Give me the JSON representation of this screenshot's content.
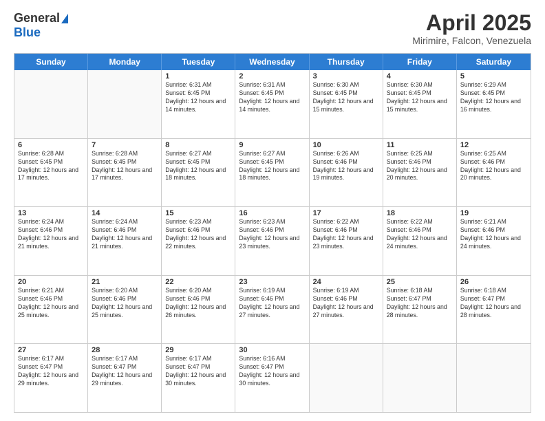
{
  "header": {
    "logo_general": "General",
    "logo_blue": "Blue",
    "month_title": "April 2025",
    "location": "Mirimire, Falcon, Venezuela"
  },
  "days_of_week": [
    "Sunday",
    "Monday",
    "Tuesday",
    "Wednesday",
    "Thursday",
    "Friday",
    "Saturday"
  ],
  "weeks": [
    [
      {
        "day": "",
        "info": ""
      },
      {
        "day": "",
        "info": ""
      },
      {
        "day": "1",
        "info": "Sunrise: 6:31 AM\nSunset: 6:45 PM\nDaylight: 12 hours and 14 minutes."
      },
      {
        "day": "2",
        "info": "Sunrise: 6:31 AM\nSunset: 6:45 PM\nDaylight: 12 hours and 14 minutes."
      },
      {
        "day": "3",
        "info": "Sunrise: 6:30 AM\nSunset: 6:45 PM\nDaylight: 12 hours and 15 minutes."
      },
      {
        "day": "4",
        "info": "Sunrise: 6:30 AM\nSunset: 6:45 PM\nDaylight: 12 hours and 15 minutes."
      },
      {
        "day": "5",
        "info": "Sunrise: 6:29 AM\nSunset: 6:45 PM\nDaylight: 12 hours and 16 minutes."
      }
    ],
    [
      {
        "day": "6",
        "info": "Sunrise: 6:28 AM\nSunset: 6:45 PM\nDaylight: 12 hours and 17 minutes."
      },
      {
        "day": "7",
        "info": "Sunrise: 6:28 AM\nSunset: 6:45 PM\nDaylight: 12 hours and 17 minutes."
      },
      {
        "day": "8",
        "info": "Sunrise: 6:27 AM\nSunset: 6:45 PM\nDaylight: 12 hours and 18 minutes."
      },
      {
        "day": "9",
        "info": "Sunrise: 6:27 AM\nSunset: 6:45 PM\nDaylight: 12 hours and 18 minutes."
      },
      {
        "day": "10",
        "info": "Sunrise: 6:26 AM\nSunset: 6:46 PM\nDaylight: 12 hours and 19 minutes."
      },
      {
        "day": "11",
        "info": "Sunrise: 6:25 AM\nSunset: 6:46 PM\nDaylight: 12 hours and 20 minutes."
      },
      {
        "day": "12",
        "info": "Sunrise: 6:25 AM\nSunset: 6:46 PM\nDaylight: 12 hours and 20 minutes."
      }
    ],
    [
      {
        "day": "13",
        "info": "Sunrise: 6:24 AM\nSunset: 6:46 PM\nDaylight: 12 hours and 21 minutes."
      },
      {
        "day": "14",
        "info": "Sunrise: 6:24 AM\nSunset: 6:46 PM\nDaylight: 12 hours and 21 minutes."
      },
      {
        "day": "15",
        "info": "Sunrise: 6:23 AM\nSunset: 6:46 PM\nDaylight: 12 hours and 22 minutes."
      },
      {
        "day": "16",
        "info": "Sunrise: 6:23 AM\nSunset: 6:46 PM\nDaylight: 12 hours and 23 minutes."
      },
      {
        "day": "17",
        "info": "Sunrise: 6:22 AM\nSunset: 6:46 PM\nDaylight: 12 hours and 23 minutes."
      },
      {
        "day": "18",
        "info": "Sunrise: 6:22 AM\nSunset: 6:46 PM\nDaylight: 12 hours and 24 minutes."
      },
      {
        "day": "19",
        "info": "Sunrise: 6:21 AM\nSunset: 6:46 PM\nDaylight: 12 hours and 24 minutes."
      }
    ],
    [
      {
        "day": "20",
        "info": "Sunrise: 6:21 AM\nSunset: 6:46 PM\nDaylight: 12 hours and 25 minutes."
      },
      {
        "day": "21",
        "info": "Sunrise: 6:20 AM\nSunset: 6:46 PM\nDaylight: 12 hours and 25 minutes."
      },
      {
        "day": "22",
        "info": "Sunrise: 6:20 AM\nSunset: 6:46 PM\nDaylight: 12 hours and 26 minutes."
      },
      {
        "day": "23",
        "info": "Sunrise: 6:19 AM\nSunset: 6:46 PM\nDaylight: 12 hours and 27 minutes."
      },
      {
        "day": "24",
        "info": "Sunrise: 6:19 AM\nSunset: 6:46 PM\nDaylight: 12 hours and 27 minutes."
      },
      {
        "day": "25",
        "info": "Sunrise: 6:18 AM\nSunset: 6:47 PM\nDaylight: 12 hours and 28 minutes."
      },
      {
        "day": "26",
        "info": "Sunrise: 6:18 AM\nSunset: 6:47 PM\nDaylight: 12 hours and 28 minutes."
      }
    ],
    [
      {
        "day": "27",
        "info": "Sunrise: 6:17 AM\nSunset: 6:47 PM\nDaylight: 12 hours and 29 minutes."
      },
      {
        "day": "28",
        "info": "Sunrise: 6:17 AM\nSunset: 6:47 PM\nDaylight: 12 hours and 29 minutes."
      },
      {
        "day": "29",
        "info": "Sunrise: 6:17 AM\nSunset: 6:47 PM\nDaylight: 12 hours and 30 minutes."
      },
      {
        "day": "30",
        "info": "Sunrise: 6:16 AM\nSunset: 6:47 PM\nDaylight: 12 hours and 30 minutes."
      },
      {
        "day": "",
        "info": ""
      },
      {
        "day": "",
        "info": ""
      },
      {
        "day": "",
        "info": ""
      }
    ]
  ]
}
